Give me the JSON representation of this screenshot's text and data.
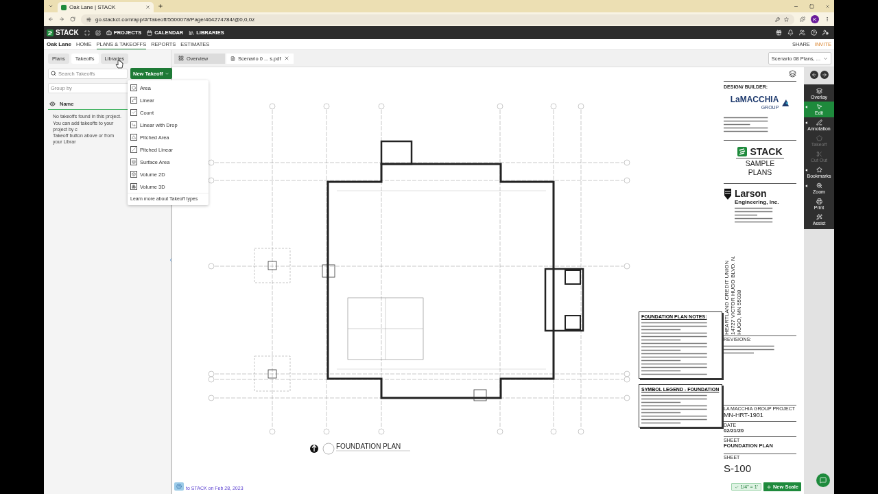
{
  "browser": {
    "tab_title": "Oak Lane | STACK",
    "url": "go.stackct.com/app/#/Takeoff/5500078/Page/464274784/@0,0,0z",
    "profile": "K"
  },
  "app_nav": {
    "logo": "STACK",
    "items": [
      "PROJECTS",
      "CALENDAR",
      "LIBRARIES"
    ]
  },
  "project_nav": {
    "project": "Oak Lane",
    "items": [
      {
        "label": "HOME",
        "selected": false
      },
      {
        "label": "PLANS & TAKEOFFS",
        "selected": true
      },
      {
        "label": "REPORTS",
        "selected": false
      },
      {
        "label": "ESTIMATES",
        "selected": false
      }
    ],
    "actions": [
      "SHARE",
      "INVITE"
    ]
  },
  "left_panel": {
    "tabs": [
      {
        "label": "Plans",
        "selected": false
      },
      {
        "label": "Takeoffs",
        "selected": true
      },
      {
        "label": "Libraries",
        "selected": false
      }
    ],
    "search": {
      "placeholder": "Search Takeoffs"
    },
    "new_takeoff": "New Takeoff",
    "group_by": {
      "placeholder": "Group by"
    },
    "column": "Name",
    "empty_message": [
      "No takeoffs found in this project.",
      "You can add takeoffs to your project by c",
      "Takeoff button above or from your Librar"
    ]
  },
  "takeoff_menu": {
    "items": [
      "Area",
      "Linear",
      "Count",
      "Linear with Drop",
      "Pitched Area",
      "Pitched Linear",
      "Surface Area",
      "Volume 2D",
      "Volume 3D"
    ],
    "footer_link": "Learn more about Takeoff types"
  },
  "viewer": {
    "tabs": [
      {
        "label": "Overview",
        "selected": false,
        "closable": false
      },
      {
        "label": "Scenario 0 ... s.pdf",
        "selected": true,
        "closable": true
      }
    ],
    "plan_set": "Scenario 08 Plans, ..."
  },
  "toolbar": [
    {
      "label": "Overlay",
      "selected": false,
      "disabled": false,
      "expandable": false
    },
    {
      "label": "Edit",
      "selected": true,
      "disabled": false,
      "expandable": true
    },
    {
      "label": "Annotation",
      "selected": false,
      "disabled": false,
      "expandable": true
    },
    {
      "label": "Takeoff",
      "selected": false,
      "disabled": true,
      "expandable": false
    },
    {
      "label": "Cut Out",
      "selected": false,
      "disabled": true,
      "expandable": false
    },
    {
      "label": "Bookmarks",
      "selected": false,
      "disabled": false,
      "expandable": true
    },
    {
      "label": "Zoom",
      "selected": false,
      "disabled": false,
      "expandable": true
    },
    {
      "label": "Print",
      "selected": false,
      "disabled": false,
      "expandable": false
    },
    {
      "label": "Assist",
      "selected": false,
      "disabled": false,
      "expandable": false
    }
  ],
  "sheet": {
    "plan_title": "FOUNDATION PLAN",
    "notes_title": "FOUNDATION PLAN NOTES:",
    "legend_title": "SYMBOL LEGEND - FOUNDATION",
    "title_block": {
      "design_builder": "DESIGN/ BUILDER:",
      "firm": "LaMACCHIA",
      "firm_sub": "GROUP",
      "stack_logo": "STACK",
      "sample": [
        "SAMPLE",
        "PLANS"
      ],
      "engineer": "Larson",
      "engineer_sub": "Engineering, Inc.",
      "project_name": [
        "HEARTLAND CREDIT UNION",
        "14727 VICTOR HUGO BLVD. N.",
        "HUGO, MN 55038"
      ],
      "revisions": "REVISIONS:",
      "fields": [
        {
          "label": "LA MACCHIA GROUP PROJECT",
          "value": "MN-HRT-1901",
          "kind": "large"
        },
        {
          "label": "DATE",
          "value": "02/21/20",
          "kind": "bold"
        },
        {
          "label": "SHEET",
          "value": "FOUNDATION PLAN",
          "kind": "bold"
        }
      ],
      "sheet_label": "SHEET",
      "sheet_number": "S-100"
    }
  },
  "footer": {
    "status": "to STACK on Feb 28, 2023",
    "scale": "1/4\" = 1'",
    "new_scale": "New Scale"
  }
}
